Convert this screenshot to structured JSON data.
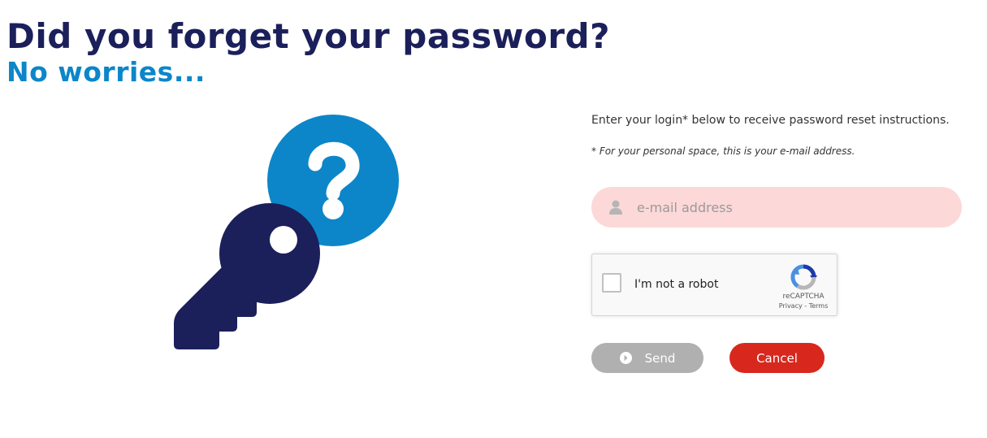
{
  "header": {
    "title": "Did you forget your password?",
    "subtitle": "No worries..."
  },
  "form": {
    "instructions": "Enter your login* below to receive password reset instructions.",
    "note": "* For your personal space, this is your e-mail address.",
    "email_placeholder": "e-mail address",
    "email_value": "",
    "email_icon": "user-icon"
  },
  "captcha": {
    "checked": false,
    "label": "I'm not a robot",
    "brand": "reCAPTCHA",
    "links": "Privacy - Terms"
  },
  "buttons": {
    "send_label": "Send",
    "send_icon": "arrow-circle-right-icon",
    "cancel_label": "Cancel"
  },
  "colors": {
    "title": "#1b1f5a",
    "subtitle": "#0c86c9",
    "key": "#1b1f5a",
    "question_circle": "#0c86c9",
    "email_field_bg": "#fdd8d8",
    "send_bg": "#b0b0b0",
    "cancel_bg": "#d8281e"
  }
}
